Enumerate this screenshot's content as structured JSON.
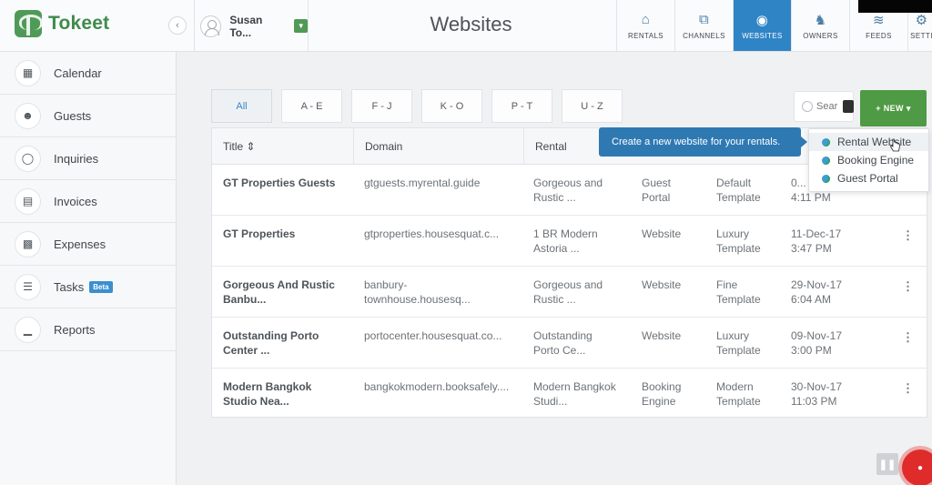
{
  "app": {
    "name": "Tokeet",
    "page_title": "Websites"
  },
  "user": {
    "name": "Susan To..."
  },
  "nav": [
    {
      "label": "RENTALS",
      "icon": "home-icon"
    },
    {
      "label": "CHANNELS",
      "icon": "share-icon"
    },
    {
      "label": "WEBSITES",
      "icon": "globe-icon",
      "active": true
    },
    {
      "label": "OWNERS",
      "icon": "owner-icon"
    },
    {
      "label": "FEEDS",
      "icon": "feed-icon"
    },
    {
      "label": "SETTI",
      "icon": "gear-icon"
    }
  ],
  "sidebar": {
    "items": [
      {
        "label": "Calendar",
        "icon": "calendar-icon"
      },
      {
        "label": "Guests",
        "icon": "guests-icon"
      },
      {
        "label": "Inquiries",
        "icon": "chat-icon"
      },
      {
        "label": "Invoices",
        "icon": "invoice-icon"
      },
      {
        "label": "Expenses",
        "icon": "money-icon"
      },
      {
        "label": "Tasks",
        "icon": "list-icon",
        "badge": "Beta"
      },
      {
        "label": "Reports",
        "icon": "chart-icon"
      }
    ]
  },
  "filters": [
    "All",
    "A - E",
    "F - J",
    "K - O",
    "P - T",
    "U - Z"
  ],
  "search": {
    "placeholder": "Sear"
  },
  "new_button": {
    "label": "+ NEW ▾"
  },
  "tooltip": {
    "text": "Create a new website for your rentals."
  },
  "new_menu": {
    "items": [
      "Rental Website",
      "Booking Engine",
      "Guest Portal"
    ]
  },
  "table": {
    "headers": {
      "title": "Title ⇕",
      "domain": "Domain",
      "rental": "Rental"
    },
    "rows": [
      {
        "title": [
          "GT Properties Guests",
          ""
        ],
        "domain": "gtguests.myrental.guide",
        "rental": [
          "Gorgeous and",
          "Rustic ..."
        ],
        "type": [
          "Guest",
          "Portal"
        ],
        "template": [
          "Default",
          "Template"
        ],
        "date": [
          "0...",
          "4:11 PM"
        ]
      },
      {
        "title": [
          "GT Properties",
          ""
        ],
        "domain": "gtproperties.housesquat.c...",
        "rental": [
          "1 BR Modern",
          "Astoria ..."
        ],
        "type": [
          "Website",
          ""
        ],
        "template": [
          "Luxury",
          "Template"
        ],
        "date": [
          "11-Dec-17",
          "3:47 PM"
        ]
      },
      {
        "title": [
          "Gorgeous And Rustic",
          "Banbu..."
        ],
        "domain": "banbury-\ntownhouse.housesq...",
        "rental": [
          "Gorgeous and",
          "Rustic ..."
        ],
        "type": [
          "Website",
          ""
        ],
        "template": [
          "Fine",
          "Template"
        ],
        "date": [
          "29-Nov-17",
          "6:04 AM"
        ]
      },
      {
        "title": [
          "Outstanding Porto",
          "Center ..."
        ],
        "domain": "portocenter.housesquat.co...",
        "rental": [
          "Outstanding",
          "Porto Ce..."
        ],
        "type": [
          "Website",
          ""
        ],
        "template": [
          "Luxury",
          "Template"
        ],
        "date": [
          "09-Nov-17",
          "3:00 PM"
        ]
      },
      {
        "title": [
          "Modern Bangkok",
          "Studio Nea..."
        ],
        "domain": "bangkokmodern.booksafely....",
        "rental": [
          "Modern Bangkok",
          "Studi..."
        ],
        "type": [
          "Booking",
          "Engine"
        ],
        "template": [
          "Modern",
          "Template"
        ],
        "date": [
          "30-Nov-17",
          "11:03 PM"
        ]
      }
    ]
  },
  "colors": {
    "brand": "#4f9a57",
    "active_nav": "#2f84c6",
    "tooltip": "#2f79b3",
    "new_button": "#4f9a44"
  }
}
